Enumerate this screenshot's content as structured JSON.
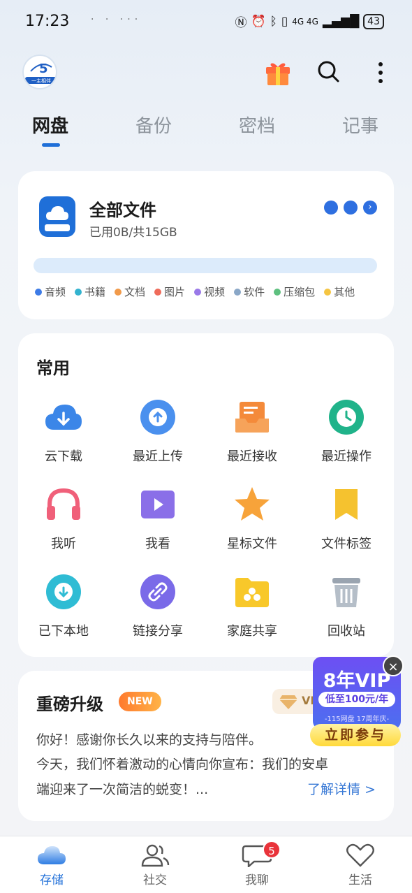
{
  "status_bar": {
    "time": "17:23",
    "dots": "· · ···",
    "network": "4G 4G",
    "battery": "43"
  },
  "header": {
    "logo_text": "一主相伴",
    "logo_number": "5"
  },
  "tabs": [
    {
      "label": "网盘",
      "active": true
    },
    {
      "label": "备份",
      "active": false
    },
    {
      "label": "密档",
      "active": false
    },
    {
      "label": "记事",
      "active": false
    }
  ],
  "files_card": {
    "title": "全部文件",
    "usage": "已用0B/共15GB",
    "legend": [
      {
        "label": "音频",
        "color": "#3d7be6"
      },
      {
        "label": "书籍",
        "color": "#33b3cf"
      },
      {
        "label": "文档",
        "color": "#f19a4a"
      },
      {
        "label": "图片",
        "color": "#ef6b5a"
      },
      {
        "label": "视频",
        "color": "#9a79e8"
      },
      {
        "label": "软件",
        "color": "#8aa7c7"
      },
      {
        "label": "压缩包",
        "color": "#5ec07f"
      },
      {
        "label": "其他",
        "color": "#f5c542"
      }
    ],
    "used_fraction": 0
  },
  "common": {
    "title": "常用",
    "items": [
      {
        "label": "云下载",
        "icon": "cloud-download-icon"
      },
      {
        "label": "最近上传",
        "icon": "upload-icon"
      },
      {
        "label": "最近接收",
        "icon": "inbox-icon"
      },
      {
        "label": "最近操作",
        "icon": "history-icon"
      },
      {
        "label": "我听",
        "icon": "headphones-icon"
      },
      {
        "label": "我看",
        "icon": "video-play-icon"
      },
      {
        "label": "星标文件",
        "icon": "star-icon"
      },
      {
        "label": "文件标签",
        "icon": "bookmark-icon"
      },
      {
        "label": "已下本地",
        "icon": "download-icon"
      },
      {
        "label": "链接分享",
        "icon": "link-icon"
      },
      {
        "label": "家庭共享",
        "icon": "family-folder-icon"
      },
      {
        "label": "回收站",
        "icon": "trash-icon"
      }
    ]
  },
  "upgrade": {
    "title": "重磅升级",
    "badge": "NEW",
    "vip_chip": "VI",
    "line1": "你好！感谢你长久以来的支持与陪伴。",
    "line2": "今天，我们怀着激动的心情向你宣布：我们的安卓",
    "line3": "端迎来了一次简洁的蜕变！...",
    "more_link": "了解详情 >"
  },
  "promo": {
    "headline": "8年VIP",
    "price": "低至100元/年",
    "subtitle": "-115网盘 17周年庆-",
    "button": "立即参与",
    "close": "×"
  },
  "bottom_nav": [
    {
      "label": "存储",
      "icon": "cloud-icon",
      "active": true
    },
    {
      "label": "社交",
      "icon": "people-icon",
      "active": false
    },
    {
      "label": "我聊",
      "icon": "chat-icon",
      "active": false,
      "badge": "5"
    },
    {
      "label": "生活",
      "icon": "heart-icon",
      "active": false
    }
  ],
  "colors": {
    "primary": "#1f6fd8",
    "badge_red": "#e9333a",
    "promo_purple": "#6d4ff3"
  }
}
